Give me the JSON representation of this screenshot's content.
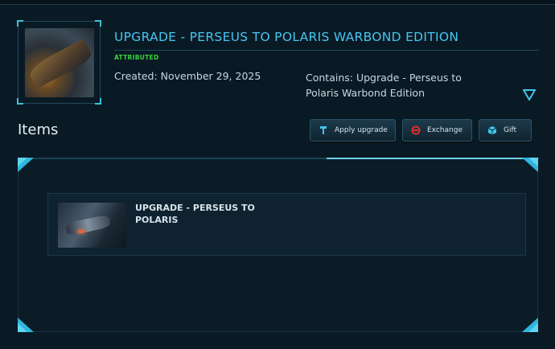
{
  "header": {
    "title": "UPGRADE - PERSEUS TO POLARIS WARBOND EDITION",
    "status": "ATTRIBUTED",
    "created": "Created: November 29, 2025",
    "contains": "Contains: Upgrade - Perseus to Polaris Warbond Edition",
    "thumbnail_icon": "ship-thumbnail",
    "expand_icon": "triangle-down-icon"
  },
  "items_section": {
    "heading": "Items"
  },
  "actions": {
    "apply_label": "Apply upgrade",
    "exchange_label": "Exchange",
    "gift_label": "Gift"
  },
  "items": [
    {
      "name": "UPGRADE - PERSEUS TO POLARIS",
      "image_icon": "ship-image"
    }
  ],
  "colors": {
    "accent": "#45c6f2",
    "status": "#3bd43b",
    "background": "#0a1a24",
    "exchange_icon": "#e0302a"
  }
}
